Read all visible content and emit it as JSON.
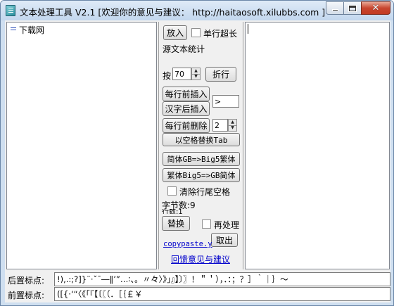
{
  "window": {
    "title": "文本处理工具 V2.1 [欢迎你的意见与建议： http://haitaosoft.xilubbs.com ]"
  },
  "left_pane": {
    "items": [
      "下载网"
    ]
  },
  "panel": {
    "insert_button": "放入",
    "single_line_label": "单行超长",
    "source_stats_label": "源文本统计",
    "per_label": "按",
    "wrap_chars_value": "70",
    "wrap_button": "折行",
    "prefix_button": "每行前插入",
    "after_chinese_button": "汉字后插入",
    "insert_text_value": ">",
    "delete_prefix_button": "每行前删除",
    "delete_count_value": "2",
    "space_to_tab_button": "以空格替换Tab",
    "gb_to_big5_button": "简体GB=>Big5繁体",
    "big5_to_gb_button": "繁体Big5=>GB简体",
    "trim_trailing_label": "清除行尾空格",
    "byte_count_label": "字节数:9",
    "line_count_label": "行数:1",
    "replace_button": "替换",
    "reprocess_label": "再处理",
    "fetch_button": "取出",
    "copypaste_link": "copypaste.y",
    "feedback_link": "回馈意见与建议"
  },
  "bottom": {
    "trailing_label": "后置标点:",
    "trailing_value": "!),.:;?]}¨·ˇˉ―‖’”…∶、。〃々〉》」』】〕〗！＂＇），．：；？］｀｜｝～",
    "leading_label": "前置标点:",
    "leading_value": "([{·‘“〈《「『【〔〖（．［｛￡￥"
  }
}
